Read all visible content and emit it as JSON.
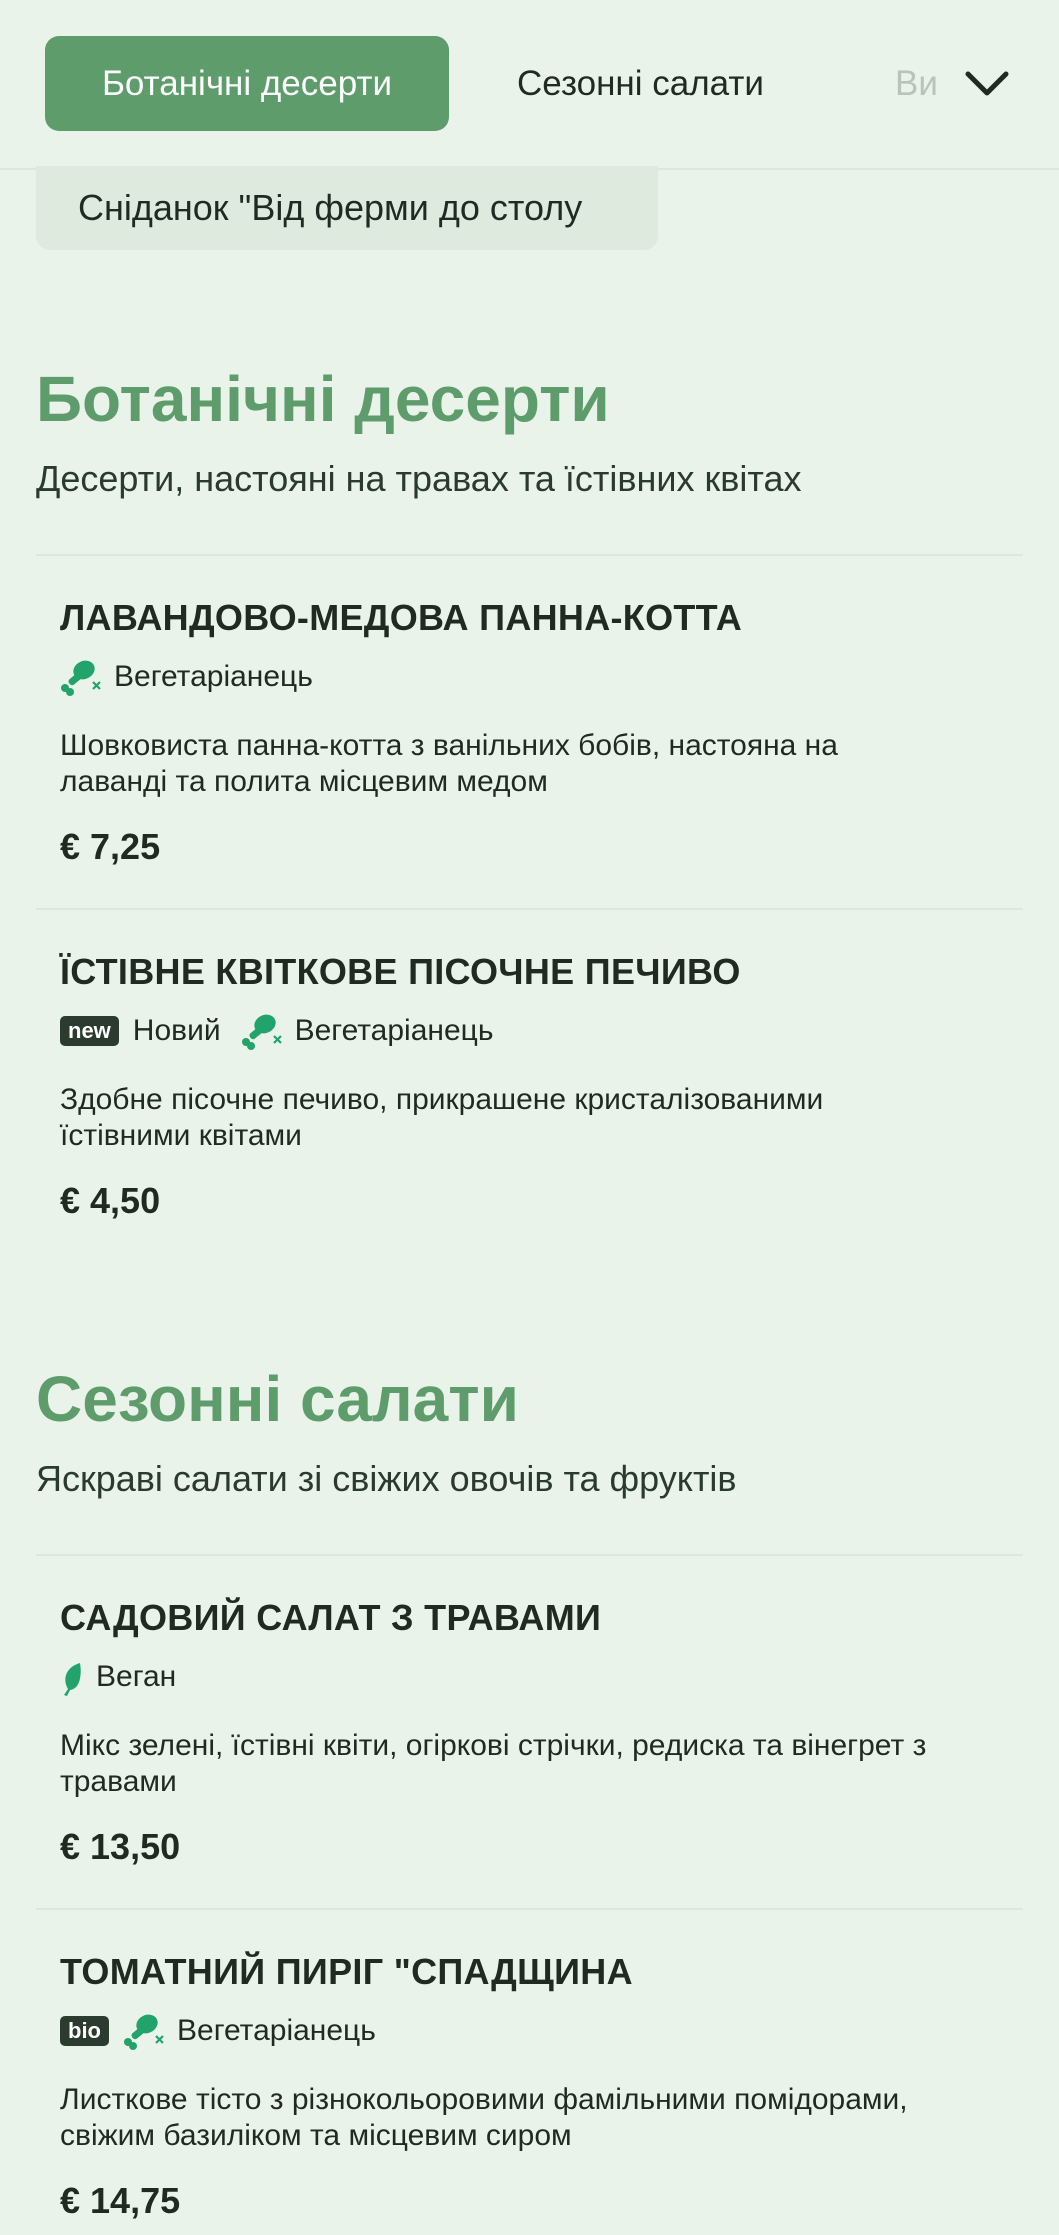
{
  "header": {
    "tabs": [
      {
        "label": "Ботанічні десерти",
        "active": true
      },
      {
        "label": "Сезонні салати",
        "active": false
      },
      {
        "label": "Ви",
        "active": false
      }
    ],
    "submenu": "Сніданок \"Від ферми до столу",
    "chevron_icon": "chevron-down-icon"
  },
  "sections": [
    {
      "title": "Ботанічні десерти",
      "subtitle": "Десерти, настояні на травах та їстівних квітах",
      "items": [
        {
          "name": "ЛАВАНДОВО-МЕДОВА ПАННА-КОТТА",
          "tags": [
            {
              "icon": "vegetarian-drumstick-icon",
              "label": "Вегетаріанець"
            }
          ],
          "description_line1": "Шовковиста панна-котта з ванільних бобів, настояна на",
          "description_line2": "лаванді та полита місцевим медом",
          "price": "€ 7,25"
        },
        {
          "name": "ЇСТІВНЕ КВІТКОВЕ ПІСОЧНЕ ПЕЧИВО",
          "badge": "new",
          "badge_label": "Новий",
          "tags": [
            {
              "icon": "vegetarian-drumstick-icon",
              "label": "Вегетаріанець"
            }
          ],
          "description_line1": "Здобне пісочне печиво, прикрашене кристалізованими",
          "description_line2": "їстівними квітами",
          "price": "€ 4,50"
        }
      ]
    },
    {
      "title": "Сезонні салати",
      "subtitle": "Яскраві салати зі свіжих овочів та фруктів",
      "items": [
        {
          "name": "САДОВИЙ САЛАТ З ТРАВАМИ",
          "tags": [
            {
              "icon": "vegan-leaf-icon",
              "label": "Веган"
            }
          ],
          "description_line1": "Мікс зелені, їстівні квіти, огіркові стрічки, редиска та вінегрет з",
          "description_line2": "травами",
          "price": "€ 13,50"
        },
        {
          "name": "ТОМАТНИЙ ПИРІГ \"СПАДЩИНА",
          "badge": "bio",
          "tags": [
            {
              "icon": "vegetarian-drumstick-icon",
              "label": "Вегетаріанець"
            }
          ],
          "description_line1": "Листкове тісто з різнокольоровими фамільними помідорами,",
          "description_line2": "свіжим базиліком та місцевим сиром",
          "price": "€ 14,75"
        }
      ]
    }
  ],
  "colors": {
    "accent": "#5e9c6c",
    "background": "#e9f3ea",
    "icon_green": "#22a36b",
    "badge_bg": "#2c3b30"
  }
}
